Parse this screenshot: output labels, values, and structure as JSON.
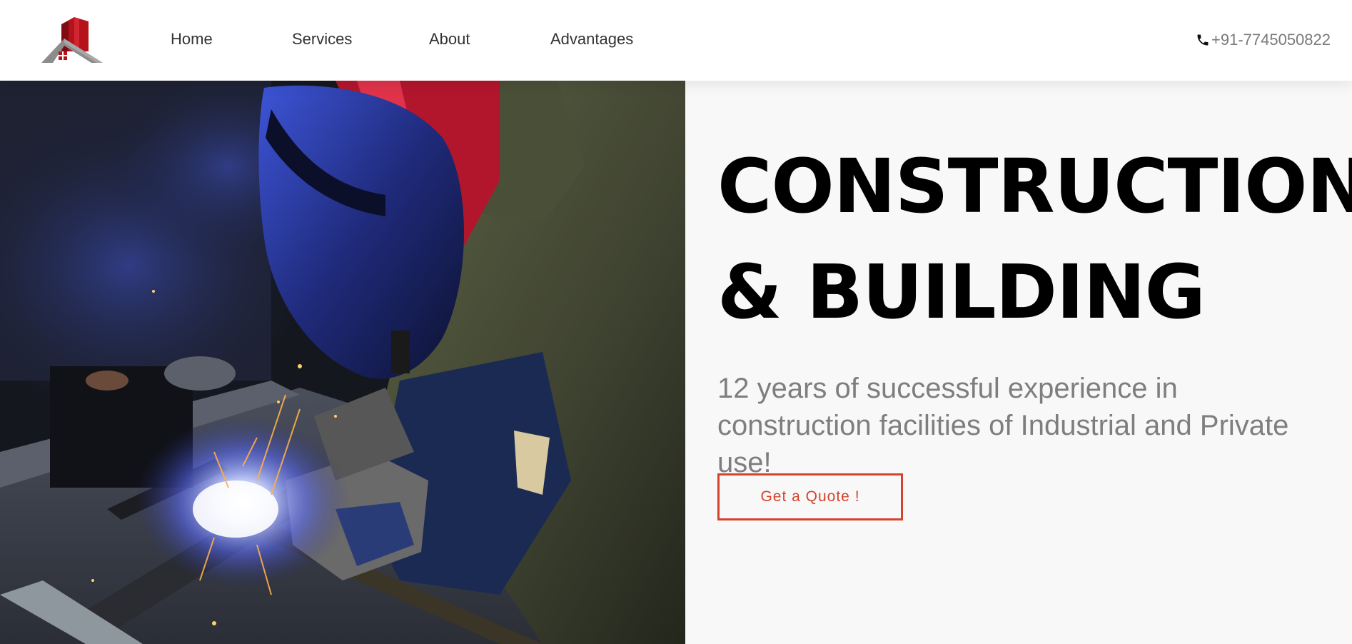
{
  "header": {
    "logo_icon": "house-building-logo",
    "nav": {
      "home": "Home",
      "services": "Services",
      "about": "About",
      "advantages": "Advantages"
    },
    "phone_icon": "phone-icon",
    "phone": "+91-7745050822"
  },
  "hero": {
    "image_subject": "welder-at-work-photo",
    "headline_line1": "CONSTRUCTION",
    "headline_line2": "& BUILDING",
    "subtext": "12 years of successful experience in construction facilities of Industrial and Private use!",
    "cta_label": "Get a Quote !"
  },
  "colors": {
    "accent": "#d5432a",
    "logo_red": "#b5121b",
    "logo_gray": "#8c8c8c",
    "hero_text_bg": "#f8f8f8"
  }
}
